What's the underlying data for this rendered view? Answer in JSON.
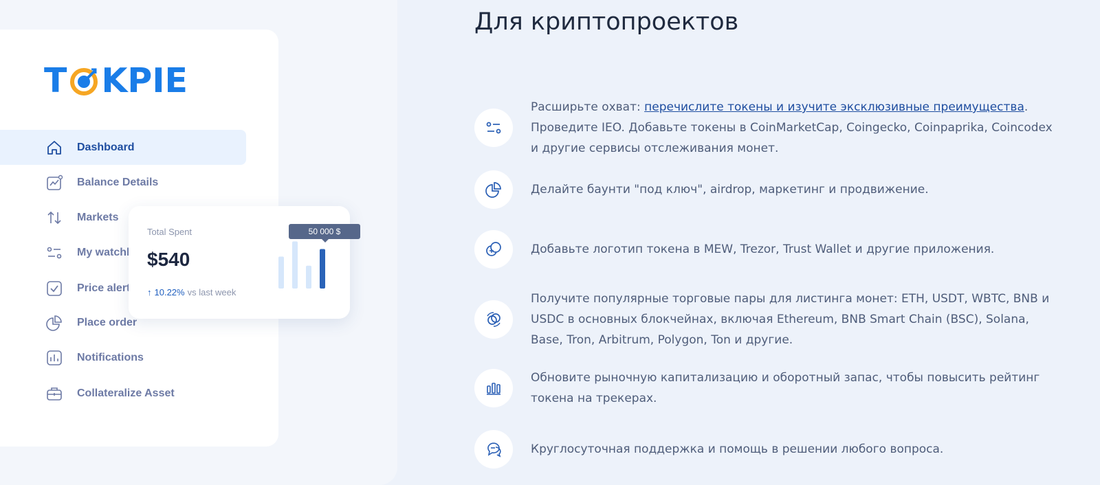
{
  "brand": {
    "logo_text_left": "T",
    "logo_text_right": "KPIE",
    "primary_color": "#1a7de8",
    "accent_color": "#f6a623"
  },
  "sidebar": {
    "items": [
      {
        "label": "Dashboard",
        "icon": "home-icon",
        "active": true
      },
      {
        "label": "Balance Details",
        "icon": "chart-line-icon",
        "active": false
      },
      {
        "label": "Markets",
        "icon": "arrows-up-down-icon",
        "active": false
      },
      {
        "label": "My watchlist",
        "icon": "sliders-icon",
        "active": false
      },
      {
        "label": "Price alerts",
        "icon": "checkbox-icon",
        "active": false
      },
      {
        "label": "Place order",
        "icon": "pie-icon",
        "active": false
      },
      {
        "label": "Notifications",
        "icon": "bar-chart-icon",
        "active": false
      },
      {
        "label": "Collateralize Asset",
        "icon": "briefcase-icon",
        "active": false
      }
    ]
  },
  "spent_card": {
    "label": "Total Spent",
    "value": "$540",
    "delta_pct": "10.22%",
    "delta_suffix": "vs last week",
    "tooltip": "50 000 $",
    "bars": [
      0.42,
      0.62,
      0.3,
      0.52
    ],
    "highlight_bar": 3
  },
  "main": {
    "heading": "Для криптопроектов",
    "features": [
      {
        "icon": "sliders-icon",
        "prefix": "Расширьте охват: ",
        "link": "перечислите токены и изучите эксклюзивные преимущества",
        "suffix": ". Проведите IEO. Добавьте токены в CoinMarketCap, Coingecko, Coinpaprika, Coincodex и другие сервисы отслеживания монет."
      },
      {
        "icon": "pie-icon",
        "text": "Делайте баунти \"под ключ\", airdrop, маркетинг и продвижение."
      },
      {
        "icon": "coins-icon",
        "text": "Добавьте логотип токена в MEW, Trezor, Trust Wallet и другие приложения."
      },
      {
        "icon": "exchange-icon",
        "text": "Получите популярные торговые пары для листинга монет: ETH, USDT, WBTC, BNB и USDC в основных блокчейнах, включая Ethereum, BNB Smart Chain (BSC), Solana, Base, Tron, Arbitrum, Polygon, Ton и другие."
      },
      {
        "icon": "bar-chart-icon",
        "text": "Обновите рыночную капитализацию и оборотный запас, чтобы повысить рейтинг токена на трекерах."
      },
      {
        "icon": "chat-icon",
        "text": "Круглосуточная поддержка и помощь в решении любого вопроса."
      }
    ]
  }
}
